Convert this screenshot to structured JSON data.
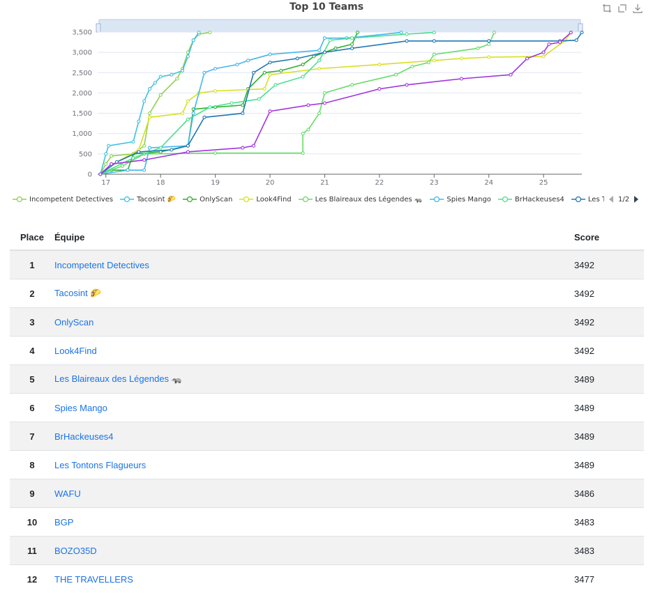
{
  "chart": {
    "title": "Top 10 Teams",
    "toolbox": [
      "zoom-icon",
      "zoom-reset-icon",
      "download-icon"
    ],
    "legend_page": "1/2"
  },
  "chart_data": {
    "type": "line",
    "title": "Top 10 Teams",
    "xlim": [
      16.85,
      25.7
    ],
    "ylim": [
      0,
      3500
    ],
    "x_ticks": [
      "17",
      "18",
      "19",
      "20",
      "21",
      "22",
      "23",
      "24",
      "25"
    ],
    "y_ticks": [
      "0",
      "500",
      "1,000",
      "1,500",
      "2,000",
      "2,500",
      "3,000",
      "3,500"
    ],
    "grid": true,
    "legend_position": "bottom",
    "series": [
      {
        "name": "Incompetent Detectives",
        "color": "#8fd14f",
        "x": [
          16.9,
          17.0,
          17.1,
          17.5,
          17.7,
          17.8,
          18.0,
          18.3,
          18.4,
          18.5,
          18.6,
          18.7,
          18.9
        ],
        "y": [
          0,
          250,
          450,
          500,
          700,
          1500,
          1950,
          2350,
          2600,
          3000,
          3300,
          3450,
          3492
        ]
      },
      {
        "name": "Tacosint 🌮",
        "color": "#3fc1e0",
        "x": [
          16.9,
          17.0,
          17.05,
          17.5,
          17.6,
          17.7,
          17.8,
          17.9,
          18.0,
          18.2,
          18.4,
          18.5,
          18.6,
          18.7
        ],
        "y": [
          0,
          500,
          700,
          800,
          1300,
          1800,
          2100,
          2250,
          2400,
          2450,
          2550,
          2900,
          3300,
          3492
        ]
      },
      {
        "name": "OnlyScan",
        "color": "#2bb02b",
        "x": [
          16.9,
          17.1,
          17.4,
          17.5,
          18.0,
          18.5,
          18.6,
          19.0,
          19.5,
          19.6,
          19.9,
          20.2,
          20.6,
          20.8,
          21.0,
          21.2,
          21.5,
          21.6
        ],
        "y": [
          0,
          100,
          100,
          500,
          550,
          700,
          1600,
          1650,
          1700,
          2100,
          2500,
          2550,
          2700,
          2900,
          3000,
          3100,
          3200,
          3492
        ]
      },
      {
        "name": "Look4Find",
        "color": "#d7e01f",
        "x": [
          16.9,
          17.2,
          17.6,
          17.8,
          18.4,
          18.5,
          18.7,
          19.0,
          19.9,
          20.0,
          20.9,
          22.0,
          23.0,
          23.5,
          24.0,
          25.0,
          25.4,
          25.5
        ],
        "y": [
          0,
          300,
          600,
          1400,
          1500,
          1800,
          2000,
          2050,
          2100,
          2450,
          2600,
          2700,
          2800,
          2850,
          2880,
          2900,
          3300,
          3492
        ]
      },
      {
        "name": "Les Blaireaux des Légendes 🦡",
        "color": "#67dc67",
        "x": [
          16.9,
          17.3,
          17.7,
          19.0,
          20.6,
          20.6,
          20.7,
          20.9,
          21.0,
          21.5,
          22.3,
          22.6,
          22.9,
          23.0,
          23.8,
          24.0,
          24.1
        ],
        "y": [
          0,
          200,
          500,
          520,
          520,
          1000,
          1100,
          1500,
          2000,
          2200,
          2450,
          2650,
          2750,
          2950,
          3100,
          3200,
          3489
        ]
      },
      {
        "name": "Spies Mango",
        "color": "#42b7ea",
        "x": [
          16.9,
          17.4,
          17.7,
          17.8,
          18.5,
          18.6,
          18.8,
          19.0,
          19.4,
          19.6,
          20.0,
          20.9,
          21.0,
          21.4,
          22.4
        ],
        "y": [
          0,
          100,
          100,
          650,
          700,
          1500,
          2500,
          2600,
          2700,
          2800,
          2950,
          3050,
          3350,
          3350,
          3489
        ]
      },
      {
        "name": "BrHackeuses4",
        "color": "#48e090",
        "x": [
          16.9,
          17.5,
          18.0,
          18.5,
          18.9,
          19.3,
          19.8,
          20.1,
          20.6,
          20.9,
          21.1,
          21.5,
          22.5,
          23.0
        ],
        "y": [
          0,
          400,
          650,
          1350,
          1650,
          1750,
          1850,
          2200,
          2400,
          2800,
          3300,
          3350,
          3450,
          3489
        ]
      },
      {
        "name": "Les Tontons Flagueurs",
        "color": "#1f78b4",
        "x": [
          16.9,
          17.2,
          17.6,
          18.2,
          18.5,
          18.8,
          19.5,
          19.7,
          20.0,
          20.5,
          21.0,
          21.5,
          22.5,
          23.0,
          24.0,
          25.3,
          25.6,
          25.7
        ],
        "y": [
          0,
          300,
          550,
          600,
          700,
          1400,
          1500,
          2500,
          2750,
          2850,
          3000,
          3100,
          3280,
          3280,
          3280,
          3280,
          3300,
          3489
        ]
      },
      {
        "name": "WAFU",
        "color": "#a134e0",
        "x": [
          16.9,
          17.1,
          17.7,
          18.5,
          19.5,
          19.7,
          20.0,
          20.7,
          21.0,
          22.0,
          22.5,
          23.5,
          24.4,
          24.7,
          25.0,
          25.1,
          25.3,
          25.5
        ],
        "y": [
          0,
          250,
          350,
          550,
          650,
          700,
          1550,
          1700,
          1750,
          2100,
          2200,
          2350,
          2450,
          2850,
          3000,
          3200,
          3250,
          3486
        ]
      }
    ]
  },
  "legend": [
    {
      "name": "Incompetent Detectives",
      "color": "#8fd14f"
    },
    {
      "name": "Tacosint 🌮",
      "color": "#3fc1e0"
    },
    {
      "name": "OnlyScan",
      "color": "#2bb02b"
    },
    {
      "name": "Look4Find",
      "color": "#d7e01f"
    },
    {
      "name": "Les Blaireaux des Légendes 🦡",
      "color": "#67dc67"
    },
    {
      "name": "Spies Mango",
      "color": "#42b7ea"
    },
    {
      "name": "BrHackeuses4",
      "color": "#48e090"
    },
    {
      "name": "Les Tontons Flagueurs",
      "color": "#1f78b4"
    }
  ],
  "scoreboard": {
    "headers": {
      "place": "Place",
      "team": "Équipe",
      "score": "Score"
    },
    "rows": [
      {
        "place": "1",
        "team": "Incompetent Detectives",
        "score": "3492"
      },
      {
        "place": "2",
        "team": "Tacosint 🌮",
        "score": "3492"
      },
      {
        "place": "3",
        "team": "OnlyScan",
        "score": "3492"
      },
      {
        "place": "4",
        "team": "Look4Find",
        "score": "3492"
      },
      {
        "place": "5",
        "team": "Les Blaireaux des Légendes 🦡",
        "score": "3489"
      },
      {
        "place": "6",
        "team": "Spies Mango",
        "score": "3489"
      },
      {
        "place": "7",
        "team": "BrHackeuses4",
        "score": "3489"
      },
      {
        "place": "8",
        "team": "Les Tontons Flagueurs",
        "score": "3489"
      },
      {
        "place": "9",
        "team": "WAFU",
        "score": "3486"
      },
      {
        "place": "10",
        "team": "BGP",
        "score": "3483"
      },
      {
        "place": "11",
        "team": "BOZO35D",
        "score": "3483"
      },
      {
        "place": "12",
        "team": "THE TRAVELLERS",
        "score": "3477"
      }
    ]
  }
}
